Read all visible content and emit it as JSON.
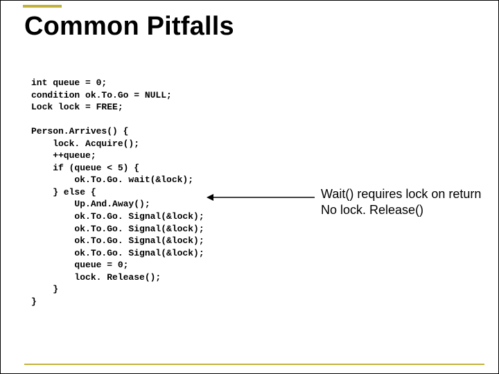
{
  "title": "Common Pitfalls",
  "code": {
    "l1": "int queue = 0;",
    "l2": "condition ok.To.Go = NULL;",
    "l3": "Lock lock = FREE;",
    "l4": "",
    "l5": "Person.Arrives() {",
    "l6": "    lock. Acquire();",
    "l7": "    ++queue;",
    "l8": "    if (queue < 5) {",
    "l9": "        ok.To.Go. wait(&lock);",
    "l10": "    } else {",
    "l11": "        Up.And.Away();",
    "l12": "        ok.To.Go. Signal(&lock);",
    "l13": "        ok.To.Go. Signal(&lock);",
    "l14": "        ok.To.Go. Signal(&lock);",
    "l15": "        ok.To.Go. Signal(&lock);",
    "l16": "        queue = 0;",
    "l17": "        lock. Release();",
    "l18": "    }",
    "l19": "}"
  },
  "annotation": {
    "line1": "Wait() requires lock on return",
    "line2": "No lock. Release()"
  }
}
